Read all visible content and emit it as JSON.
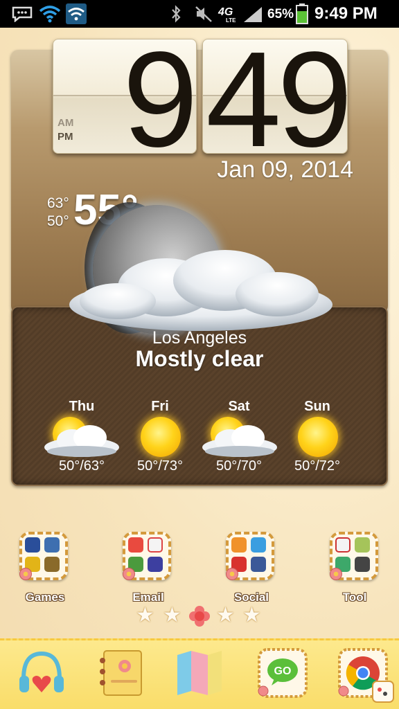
{
  "status_bar": {
    "time": "9:49 PM",
    "battery_percent": "65%",
    "network": "4G",
    "network_sub": "LTE",
    "icons": [
      "bbm-icon",
      "wifi-icon",
      "wifi-boxed-icon",
      "bluetooth-icon",
      "mute-icon",
      "signal-icon",
      "battery-icon"
    ],
    "battery_level": 0.65
  },
  "clock": {
    "hour": "9",
    "minutes": "49",
    "am_label": "AM",
    "pm_label": "PM",
    "date": "Jan 09, 2014"
  },
  "weather": {
    "high": "63°",
    "low": "50°",
    "current_temp": "55°",
    "city": "Los Angeles",
    "condition": "Mostly clear",
    "forecast": [
      {
        "day": "Thu",
        "range": "50°/63°",
        "icon": "partly-cloudy-icon"
      },
      {
        "day": "Fri",
        "range": "50°/73°",
        "icon": "sunny-icon"
      },
      {
        "day": "Sat",
        "range": "50°/70°",
        "icon": "partly-cloudy-icon"
      },
      {
        "day": "Sun",
        "range": "50°/72°",
        "icon": "sunny-icon"
      }
    ]
  },
  "folders": [
    {
      "label": "Games"
    },
    {
      "label": "Email"
    },
    {
      "label": "Social"
    },
    {
      "label": "Tool"
    }
  ],
  "page_indicator": {
    "pages": 5,
    "current": 3
  },
  "dock": [
    {
      "name": "music-app-icon"
    },
    {
      "name": "contacts-app-icon"
    },
    {
      "name": "maps-app-icon"
    },
    {
      "name": "go-sms-app-icon"
    },
    {
      "name": "chrome-app-icon"
    }
  ],
  "colors": {
    "status_bar_bg": "#000000",
    "wallpaper": "#fbeccb",
    "widget_top": "#a88a5e",
    "widget_bottom": "#5a422b",
    "dock": "#fbe37c",
    "battery_fill": "#5bc236",
    "sun": "#ffd31a"
  }
}
